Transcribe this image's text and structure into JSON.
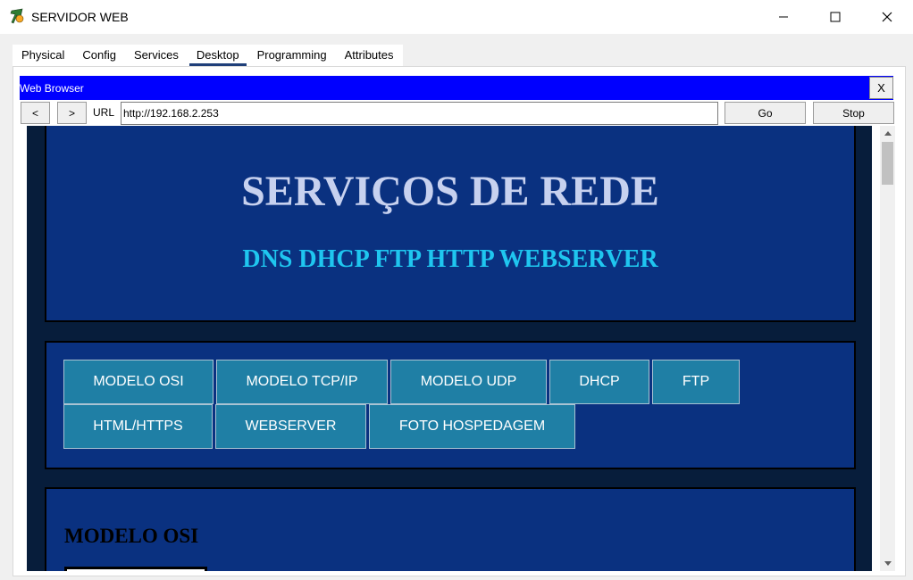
{
  "window": {
    "title": "SERVIDOR WEB",
    "icon": "packet-tracer-server-icon"
  },
  "tabs": [
    {
      "label": "Physical",
      "active": false
    },
    {
      "label": "Config",
      "active": false
    },
    {
      "label": "Services",
      "active": false
    },
    {
      "label": "Desktop",
      "active": true
    },
    {
      "label": "Programming",
      "active": false
    },
    {
      "label": "Attributes",
      "active": false
    }
  ],
  "browser": {
    "title": "Web Browser",
    "close_label": "X",
    "back_label": "<",
    "forward_label": ">",
    "url_label": "URL",
    "url_value": "http://192.168.2.253",
    "go_label": "Go",
    "stop_label": "Stop"
  },
  "page": {
    "title": "SERVIÇOS DE REDE",
    "subtitle": "DNS DHCP FTP HTTP WEBSERVER",
    "menu": [
      "MODELO OSI",
      "MODELO TCP/IP",
      "MODELO UDP",
      "DHCP",
      "FTP",
      "HTML/HTTPS",
      "WEBSERVER",
      "FOTO HOSPEDAGEM"
    ],
    "section_title": "MODELO OSI"
  },
  "colors": {
    "browser_titlebar": "#0000ff",
    "page_background": "#071d3b",
    "panel": "#0a3180",
    "title_text": "#c7d1ef",
    "subtitle_text": "#1fc6ef",
    "menu_button": "#1f7fa5"
  }
}
